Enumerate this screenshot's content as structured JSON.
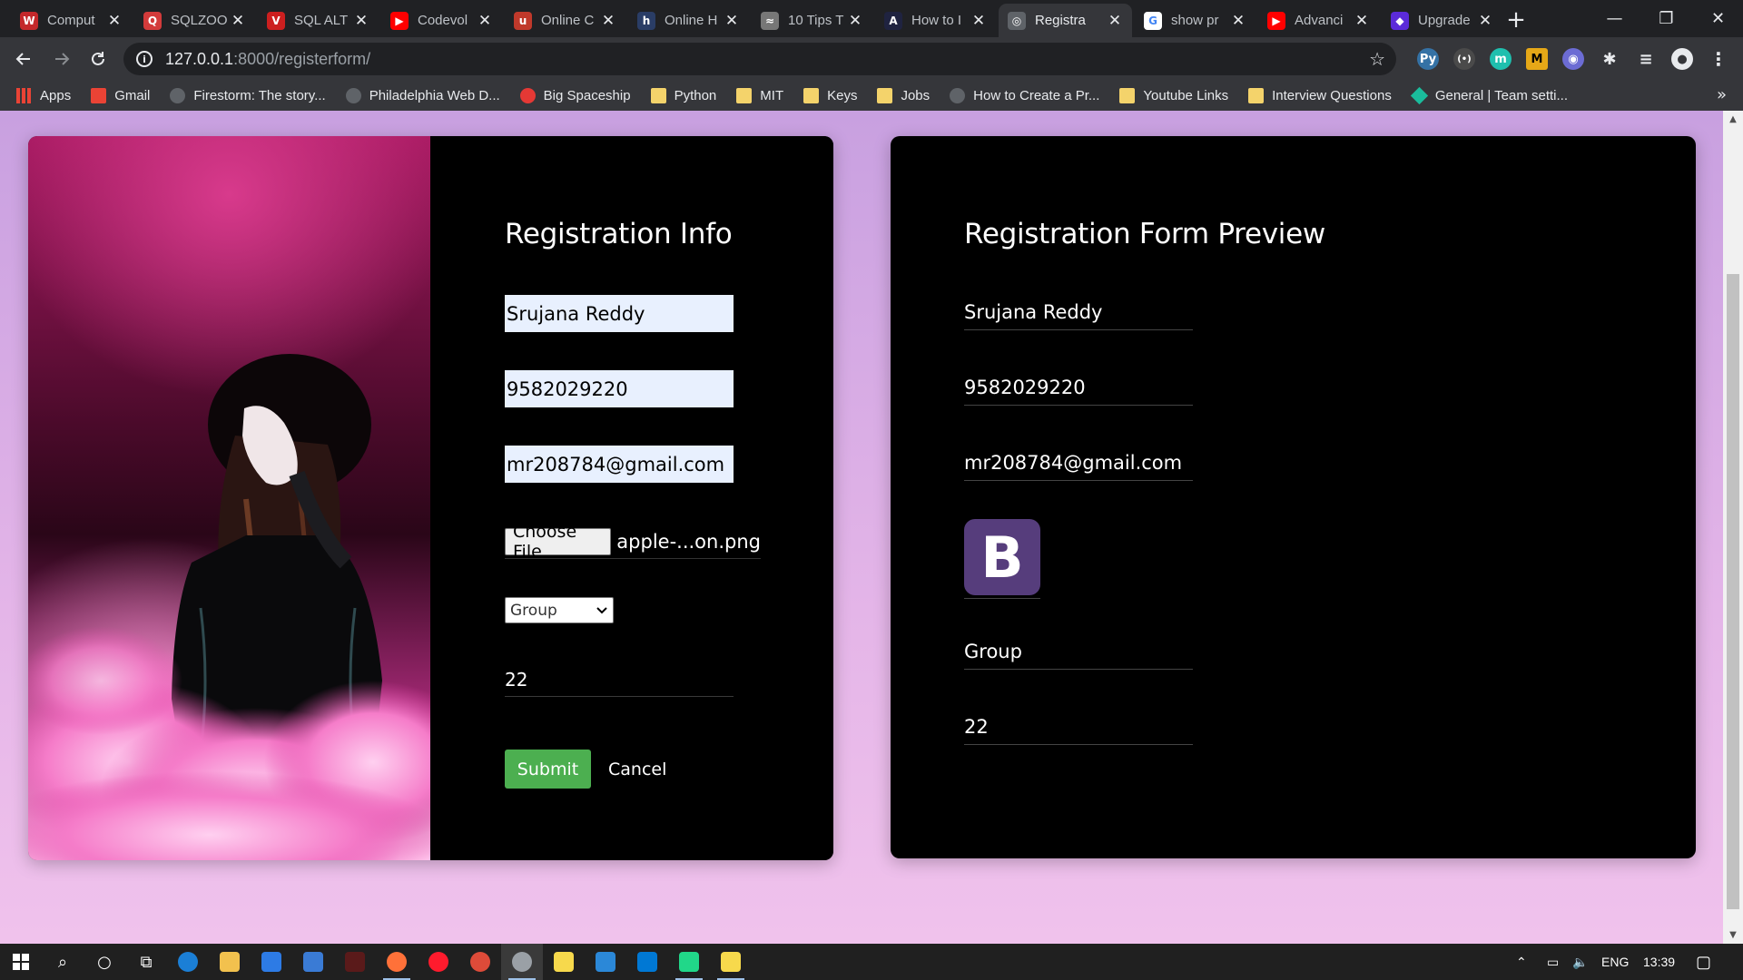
{
  "browser": {
    "tabs": [
      {
        "title": "Comput",
        "fav_color": "#c4282b",
        "fav_char": "W"
      },
      {
        "title": "SQLZOO",
        "fav_color": "#d33b3b",
        "fav_char": "Q"
      },
      {
        "title": "SQL ALT",
        "fav_color": "#cc1f1f",
        "fav_char": "V"
      },
      {
        "title": "Codevol",
        "fav_color": "#ff0000",
        "fav_char": "▶"
      },
      {
        "title": "Online C",
        "fav_color": "#c0392b",
        "fav_char": "u"
      },
      {
        "title": "Online H",
        "fav_color": "#2a3d66",
        "fav_char": "h"
      },
      {
        "title": "10 Tips T",
        "fav_color": "#777777",
        "fav_char": "≈"
      },
      {
        "title": "How to I",
        "fav_color": "#1f2340",
        "fav_char": "A"
      },
      {
        "title": "Registra",
        "fav_color": "#5f6368",
        "fav_char": "◎"
      },
      {
        "title": "show pr",
        "fav_color": "#ffffff",
        "fav_char": "G"
      },
      {
        "title": "Advanci",
        "fav_color": "#ff0000",
        "fav_char": "▶"
      },
      {
        "title": "Upgrade",
        "fav_color": "#5b2bd9",
        "fav_char": "◆"
      }
    ],
    "active_tab_index": 8,
    "url_host": "127.0.0.1",
    "url_path": ":8000/registerform/",
    "bookmarks": [
      {
        "label": "Apps",
        "kind": "apps"
      },
      {
        "label": "Gmail",
        "kind": "gmail"
      },
      {
        "label": "Firestorm: The story...",
        "kind": "site"
      },
      {
        "label": "Philadelphia Web D...",
        "kind": "site"
      },
      {
        "label": "Big Spaceship",
        "kind": "red"
      },
      {
        "label": "Python",
        "kind": "folder"
      },
      {
        "label": "MIT",
        "kind": "folder"
      },
      {
        "label": "Keys",
        "kind": "folder"
      },
      {
        "label": "Jobs",
        "kind": "folder"
      },
      {
        "label": "How to Create a Pr...",
        "kind": "site"
      },
      {
        "label": "Youtube Links",
        "kind": "folder"
      },
      {
        "label": "Interview Questions",
        "kind": "folder"
      },
      {
        "label": "General | Team setti...",
        "kind": "teal"
      }
    ]
  },
  "form": {
    "heading": "Registration Info",
    "name_value": "Srujana Reddy",
    "phone_value": "9582029220",
    "email_value": "mr208784@gmail.com",
    "file_button": "Choose File",
    "file_name": "apple-...on.png",
    "select_value": "Group",
    "age_value": "22",
    "submit_label": "Submit",
    "cancel_label": "Cancel"
  },
  "preview": {
    "heading": "Registration Form Preview",
    "name": "Srujana Reddy",
    "phone": "9582029220",
    "email": "mr208784@gmail.com",
    "logo_letter": "B",
    "group": "Group",
    "age": "22"
  },
  "taskbar": {
    "language": "ENG",
    "time": "13:39"
  }
}
